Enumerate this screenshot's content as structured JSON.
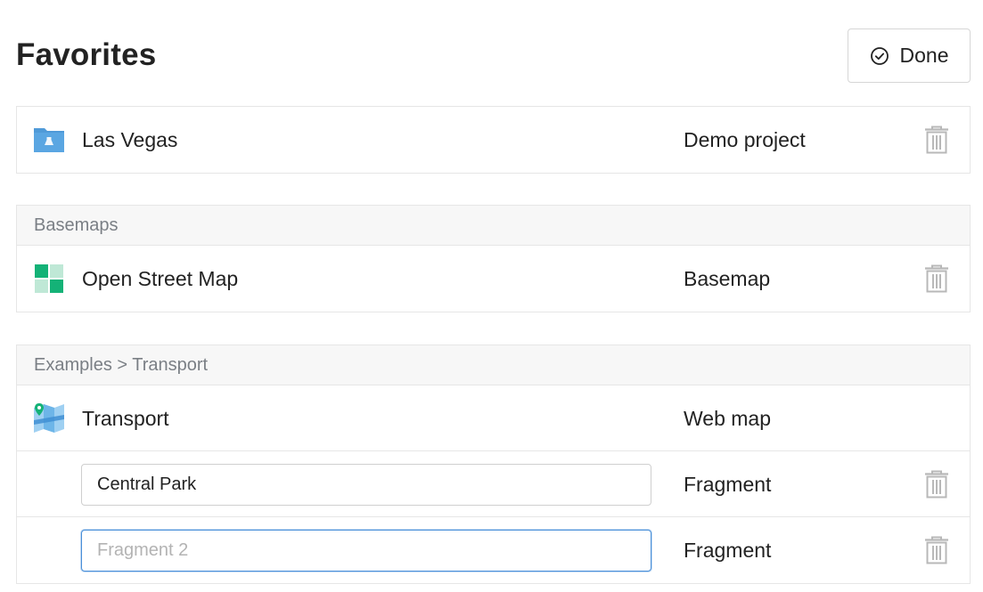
{
  "header": {
    "title": "Favorites",
    "done_label": "Done"
  },
  "groups": [
    {
      "header": "",
      "rows": [
        {
          "icon": "project-folder-icon",
          "name": "Las Vegas",
          "type": "Demo project",
          "deletable": true
        }
      ]
    },
    {
      "header": "Basemaps",
      "rows": [
        {
          "icon": "basemap-icon",
          "name": "Open Street Map",
          "type": "Basemap",
          "deletable": true
        }
      ]
    },
    {
      "header": "Examples > Transport",
      "rows": [
        {
          "icon": "web-map-icon",
          "name": "Transport",
          "type": "Web map",
          "deletable": false
        },
        {
          "kind": "fragment-input",
          "value": "Central Park",
          "placeholder": "",
          "type": "Fragment",
          "deletable": true
        },
        {
          "kind": "fragment-input",
          "value": "",
          "placeholder": "Fragment 2",
          "type": "Fragment",
          "deletable": true,
          "focused": true
        }
      ]
    }
  ],
  "colors": {
    "accent": "#4a90d9",
    "folder": "#4f9ad8",
    "basemap_green": "#14b277",
    "trash": "#b8b8b8"
  }
}
